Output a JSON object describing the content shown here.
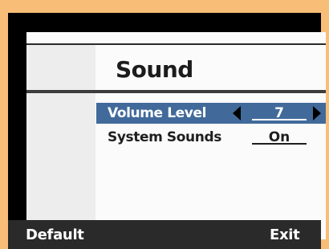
{
  "screen": {
    "title": "Sound"
  },
  "menu": {
    "items": [
      {
        "label": "Volume Level",
        "value": "7"
      },
      {
        "label": "System Sounds",
        "value": "On"
      }
    ]
  },
  "softkeys": {
    "left": "Default",
    "right": "Exit"
  },
  "colors": {
    "frame_background": "#f8be78",
    "selection": "#416a9b"
  },
  "icons": {
    "left": "left-arrow-icon",
    "right": "right-arrow-icon"
  }
}
